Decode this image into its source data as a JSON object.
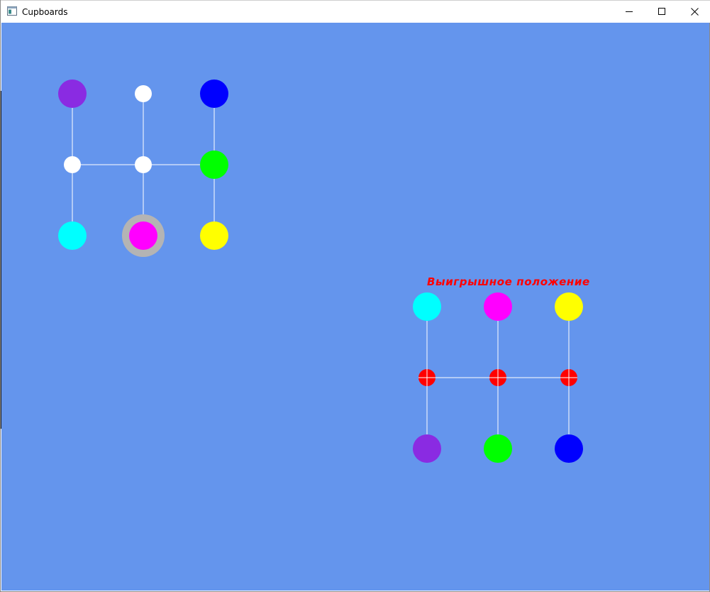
{
  "window": {
    "title": "Cupboards",
    "app_icon": "window-app-icon",
    "controls": [
      {
        "name": "minimize-button",
        "icon": "minimize-icon"
      },
      {
        "name": "maximize-button",
        "icon": "maximize-icon"
      },
      {
        "name": "close-button",
        "icon": "close-icon"
      }
    ]
  },
  "game": {
    "background_color": "#6495ed",
    "line_color": "#ffffff",
    "current_board": {
      "nodes": [
        {
          "id": 1,
          "color": "#8a2be2",
          "kind": "piece"
        },
        {
          "id": 2,
          "color": "#ffffff",
          "kind": "empty"
        },
        {
          "id": 3,
          "color": "#0000ff",
          "kind": "piece"
        },
        {
          "id": 4,
          "color": "#ffffff",
          "kind": "empty"
        },
        {
          "id": 5,
          "color": "#ffffff",
          "kind": "empty"
        },
        {
          "id": 6,
          "color": "#00ff00",
          "kind": "piece"
        },
        {
          "id": 7,
          "color": "#00ffff",
          "kind": "piece"
        },
        {
          "id": 8,
          "color": "#ff00ff",
          "kind": "piece",
          "selected": true
        },
        {
          "id": 9,
          "color": "#ffff00",
          "kind": "piece"
        }
      ],
      "connections": [
        [
          1,
          4
        ],
        [
          4,
          7
        ],
        [
          2,
          5
        ],
        [
          5,
          8
        ],
        [
          3,
          6
        ],
        [
          6,
          9
        ],
        [
          4,
          5
        ],
        [
          5,
          6
        ]
      ],
      "selection_ring_color": "#b4b4b4"
    },
    "winning_board": {
      "label": "Выигрышное положение",
      "label_color": "#ff0000",
      "nodes": [
        {
          "id": 1,
          "color": "#00ffff",
          "kind": "piece"
        },
        {
          "id": 2,
          "color": "#ff00ff",
          "kind": "piece"
        },
        {
          "id": 3,
          "color": "#ffff00",
          "kind": "piece"
        },
        {
          "id": 4,
          "color": "#ff0000",
          "kind": "empty"
        },
        {
          "id": 5,
          "color": "#ff0000",
          "kind": "empty"
        },
        {
          "id": 6,
          "color": "#ff0000",
          "kind": "empty"
        },
        {
          "id": 7,
          "color": "#8a2be2",
          "kind": "piece"
        },
        {
          "id": 8,
          "color": "#00ff00",
          "kind": "piece"
        },
        {
          "id": 9,
          "color": "#0000ff",
          "kind": "piece"
        }
      ],
      "connections": [
        [
          1,
          4
        ],
        [
          4,
          7
        ],
        [
          2,
          5
        ],
        [
          5,
          8
        ],
        [
          3,
          6
        ],
        [
          6,
          9
        ],
        [
          4,
          5
        ],
        [
          5,
          6
        ]
      ]
    }
  }
}
